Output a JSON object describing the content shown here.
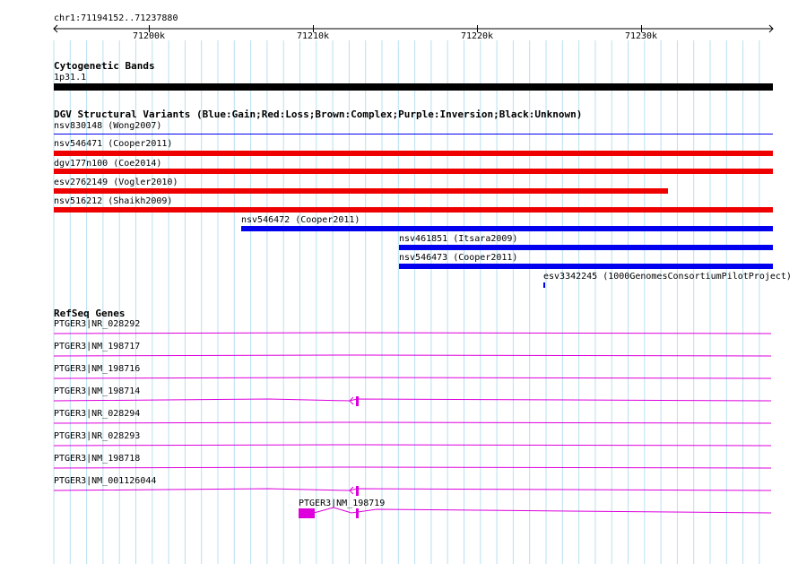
{
  "ruler": {
    "range_label": "chr1:71194152..71237880",
    "ticks": [
      "71200k",
      "71210k",
      "71220k",
      "71230k"
    ]
  },
  "cytoband": {
    "title": "Cytogenetic Bands",
    "band": "1p31.1",
    "color": "#000000"
  },
  "dgv": {
    "title": "DGV Structural Variants (Blue:Gain;Red:Loss;Brown:Complex;Purple:Inversion;Black:Unknown)",
    "colors": {
      "gain": "#0000ee",
      "loss": "#ee0000"
    },
    "features": [
      {
        "label": "nsv830148 (Wong2007)",
        "type": "gain"
      },
      {
        "label": "nsv546471 (Cooper2011)",
        "type": "loss"
      },
      {
        "label": "dgv177n100 (Coe2014)",
        "type": "loss"
      },
      {
        "label": "esv2762149 (Vogler2010)",
        "type": "loss"
      },
      {
        "label": "nsv516212 (Shaikh2009)",
        "type": "loss"
      },
      {
        "label": "nsv546472 (Cooper2011)",
        "type": "gain"
      },
      {
        "label": "nsv461851 (Itsara2009)",
        "type": "gain"
      },
      {
        "label": "nsv546473 (Cooper2011)",
        "type": "gain"
      },
      {
        "label": "esv3342245 (1000GenomesConsortiumPilotProject)",
        "type": "gain"
      }
    ]
  },
  "refseq": {
    "title": "RefSeq Genes",
    "color": "#dd00dd",
    "genes": [
      "PTGER3|NR_028292",
      "PTGER3|NM_198717",
      "PTGER3|NM_198716",
      "PTGER3|NM_198714",
      "PTGER3|NR_028294",
      "PTGER3|NR_028293",
      "PTGER3|NM_198718",
      "PTGER3|NM_001126044",
      "PTGER3|NM_198719"
    ]
  }
}
